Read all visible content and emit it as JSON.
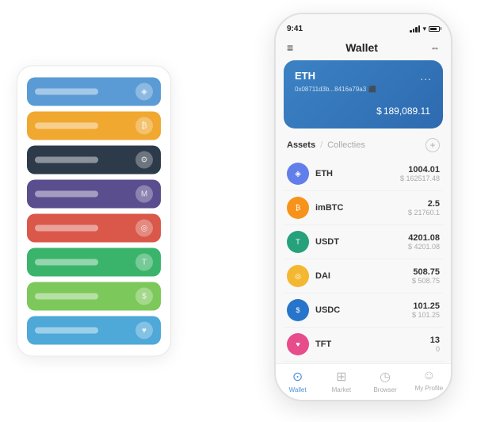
{
  "scene": {
    "background": "#ffffff"
  },
  "card_stack": {
    "cards": [
      {
        "color": "blue",
        "class": "card-blue"
      },
      {
        "color": "orange",
        "class": "card-orange"
      },
      {
        "color": "dark",
        "class": "card-dark"
      },
      {
        "color": "purple",
        "class": "card-purple"
      },
      {
        "color": "red",
        "class": "card-red"
      },
      {
        "color": "green",
        "class": "card-green"
      },
      {
        "color": "lightgreen",
        "class": "card-lightgreen"
      },
      {
        "color": "lightblue",
        "class": "card-lightblue"
      }
    ]
  },
  "phone": {
    "status_time": "9:41",
    "header_title": "Wallet",
    "eth_card": {
      "name": "ETH",
      "address": "0x08711d3b...8416a79a3",
      "more": "...",
      "balance_symbol": "$",
      "balance": "189,089.11"
    },
    "assets_section": {
      "tab_active": "Assets",
      "tab_divider": "/",
      "tab_inactive": "Collecties"
    },
    "assets": [
      {
        "name": "ETH",
        "icon": "◈",
        "icon_class": "icon-eth",
        "primary": "1004.01",
        "secondary": "$ 162517.48"
      },
      {
        "name": "imBTC",
        "icon": "₿",
        "icon_class": "icon-imbtc",
        "primary": "2.5",
        "secondary": "$ 21760.1"
      },
      {
        "name": "USDT",
        "icon": "T",
        "icon_class": "icon-usdt",
        "primary": "4201.08",
        "secondary": "$ 4201.08"
      },
      {
        "name": "DAI",
        "icon": "◎",
        "icon_class": "icon-dai",
        "primary": "508.75",
        "secondary": "$ 508.75"
      },
      {
        "name": "USDC",
        "icon": "$",
        "icon_class": "icon-usdc",
        "primary": "101.25",
        "secondary": "$ 101.25"
      },
      {
        "name": "TFT",
        "icon": "♥",
        "icon_class": "icon-tft",
        "primary": "13",
        "secondary": "0"
      }
    ],
    "nav": [
      {
        "label": "Wallet",
        "icon": "⊙",
        "active": true
      },
      {
        "label": "Market",
        "icon": "⊞",
        "active": false
      },
      {
        "label": "Browser",
        "icon": "◷",
        "active": false
      },
      {
        "label": "My Profile",
        "icon": "☺",
        "active": false
      }
    ]
  }
}
